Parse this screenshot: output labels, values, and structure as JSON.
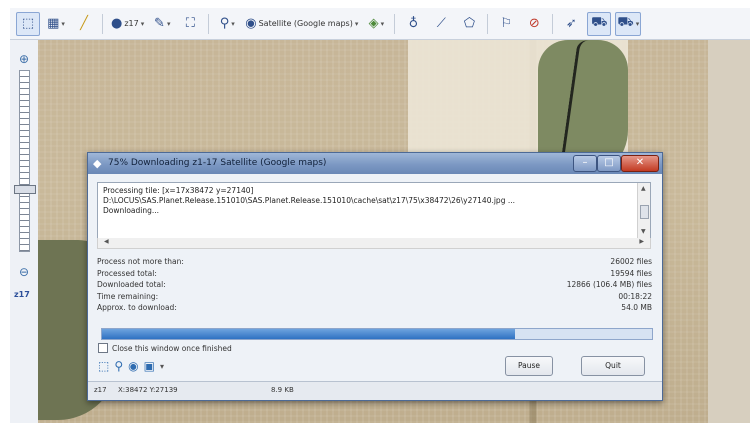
{
  "toolbar": {
    "zoom_label": "z17",
    "map_source_label": "Satellite (Google maps)"
  },
  "zoom_panel": {
    "level_label": "z17",
    "slider_level_fraction": 0.66
  },
  "dialog": {
    "title": "75% Downloading z1-17 Satellite (Google maps)",
    "log_lines": [
      "Processing tile: [x=17x38472 y=27140]",
      "D:\\LOCUS\\SAS.Planet.Release.151010\\SAS.Planet.Release.151010\\cache\\sat\\z17\\75\\x38472\\26\\y27140.jpg ...",
      "Downloading..."
    ],
    "stats": [
      {
        "label": "Process not more than:",
        "value": "26002 files"
      },
      {
        "label": "Processed total:",
        "value": "19594 files"
      },
      {
        "label": "Downloaded total:",
        "value": "12866 (106.4 MB) files"
      },
      {
        "label": "Time remaining:",
        "value": "00:18:22"
      },
      {
        "label": "Approx. to download:",
        "value": "54.0 MB"
      }
    ],
    "progress_percent": 75,
    "close_checkbox_label": "Close this window once finished",
    "close_checkbox_checked": false,
    "pause_label": "Pause",
    "quit_label": "Quit",
    "status": {
      "zoom": "z17",
      "coords": "X:38472 Y:27139",
      "size": "8.9 KB"
    }
  }
}
